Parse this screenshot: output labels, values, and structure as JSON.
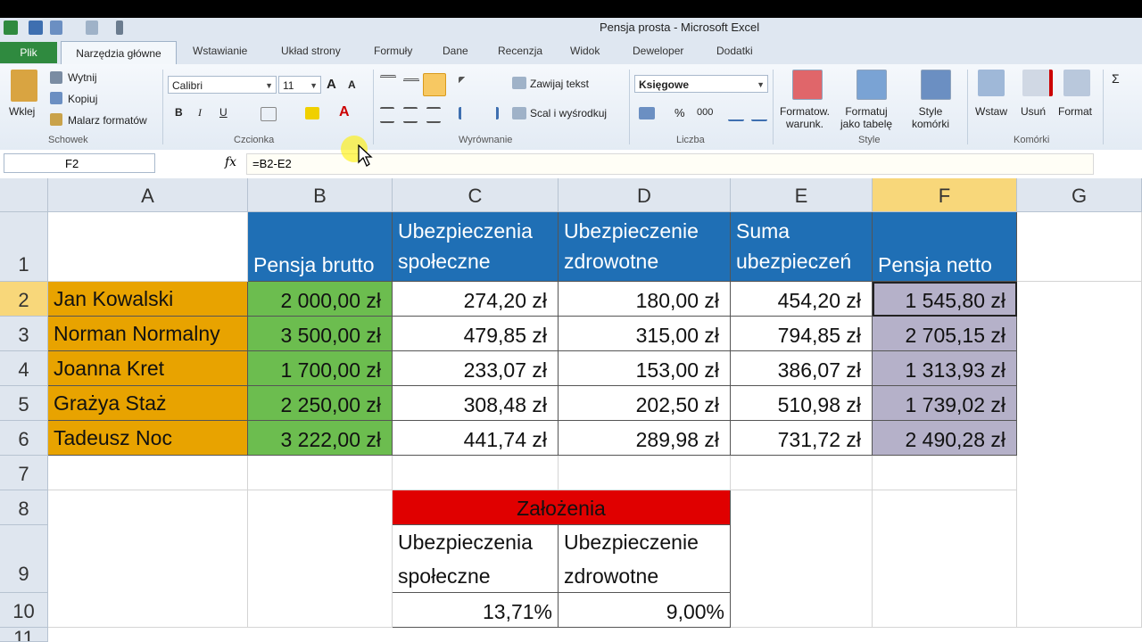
{
  "window": {
    "title": "Pensja prosta - Microsoft Excel"
  },
  "tabs": {
    "file": "Plik",
    "items": [
      "Narzędzia główne",
      "Wstawianie",
      "Układ strony",
      "Formuły",
      "Dane",
      "Recenzja",
      "Widok",
      "Deweloper",
      "Dodatki"
    ]
  },
  "ribbon": {
    "clipboard": {
      "paste": "Wklej",
      "cut": "Wytnij",
      "copy": "Kopiuj",
      "format_painter": "Malarz formatów",
      "group": "Schowek"
    },
    "font": {
      "name": "Calibri",
      "size": "11",
      "bold": "B",
      "italic": "I",
      "underline": "U",
      "group": "Czcionka"
    },
    "alignment": {
      "wrap": "Zawijaj tekst",
      "merge": "Scal i wyśrodkuj",
      "group": "Wyrównanie"
    },
    "number": {
      "format": "Księgowe",
      "percent": "%",
      "thousands": "000",
      "group": "Liczba"
    },
    "styles": {
      "conditional": "Formatow.\nwarunk.",
      "table": "Formatuj\njako tabelę",
      "cell_styles": "Style\nkomórki",
      "group": "Style"
    },
    "cells": {
      "insert": "Wstaw",
      "delete": "Usuń",
      "format": "Format",
      "group": "Komórki"
    }
  },
  "formula_bar": {
    "name_box": "F2",
    "fx": "fx",
    "formula": "=B2-E2"
  },
  "columns": [
    "A",
    "B",
    "C",
    "D",
    "E",
    "F",
    "G"
  ],
  "rows": [
    "1",
    "2",
    "3",
    "4",
    "5",
    "6",
    "7",
    "8",
    "9",
    "10",
    "11"
  ],
  "header_row": [
    "Pensja brutto",
    "Ubezpieczenia\nspołeczne",
    "Ubezpieczenie\nzdrowotne",
    "Suma\nubezpieczeń",
    "Pensja netto"
  ],
  "table": [
    {
      "name": "Jan Kowalski",
      "brutto": "2 000,00 zł",
      "spol": "274,20 zł",
      "zdrow": "180,00 zł",
      "suma": "454,20 zł",
      "netto": "1 545,80 zł"
    },
    {
      "name": "Norman Normalny",
      "brutto": "3 500,00 zł",
      "spol": "479,85 zł",
      "zdrow": "315,00 zł",
      "suma": "794,85 zł",
      "netto": "2 705,15 zł"
    },
    {
      "name": "Joanna Kret",
      "brutto": "1 700,00 zł",
      "spol": "233,07 zł",
      "zdrow": "153,00 zł",
      "suma": "386,07 zł",
      "netto": "1 313,93 zł"
    },
    {
      "name": "Grażya Staż",
      "brutto": "2 250,00 zł",
      "spol": "308,48 zł",
      "zdrow": "202,50 zł",
      "suma": "510,98 zł",
      "netto": "1 739,02 zł"
    },
    {
      "name": "Tadeusz Noc",
      "brutto": "3 222,00 zł",
      "spol": "441,74 zł",
      "zdrow": "289,98 zł",
      "suma": "731,72 zł",
      "netto": "2 490,28 zł"
    }
  ],
  "assumptions": {
    "title": "Założenia",
    "label1": "Ubezpieczenia\nspołeczne",
    "label2": "Ubezpieczenie\nzdrowotne",
    "value1": "13,71%",
    "value2": "9,00%"
  },
  "colors": {
    "header_blue": "#1f6fb5",
    "name_orange": "#e8a300",
    "brutto_green": "#6cbd4f",
    "netto_purple": "#b5b1c9",
    "assump_red": "#e00000",
    "file_tab": "#2f8a3f"
  }
}
